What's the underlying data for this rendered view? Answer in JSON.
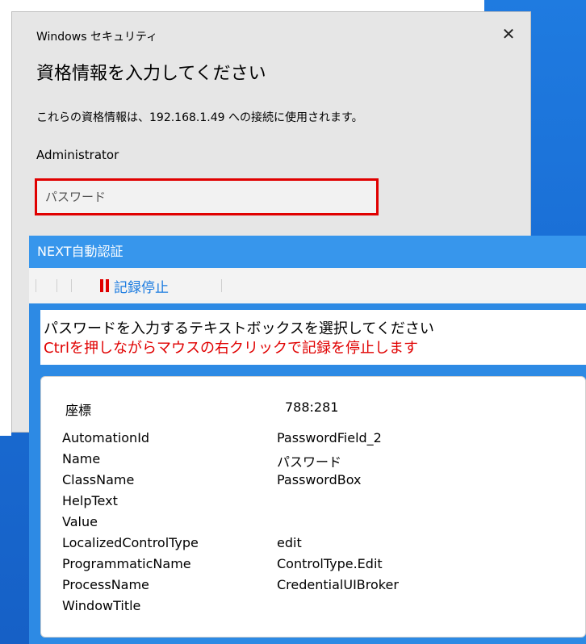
{
  "dialog": {
    "title": "Windows セキュリティ",
    "close_glyph": "✕",
    "heading": "資格情報を入力してください",
    "description": "これらの資格情報は、192.168.1.49 への接続に使用されます。",
    "username": "Administrator",
    "password_placeholder": "パスワード"
  },
  "next_window": {
    "title": "NEXT自動認証",
    "stop_label": "記録停止",
    "instruction_1": "パスワードを入力するテキストボックスを選択してください",
    "instruction_2": "Ctrlを押しながらマウスの右クリックで記録を停止します",
    "coord_label": "座標",
    "coord_value": "788:281",
    "properties": [
      {
        "key": "AutomationId",
        "value": "PasswordField_2"
      },
      {
        "key": "Name",
        "value": "パスワード"
      },
      {
        "key": "ClassName",
        "value": "PasswordBox"
      },
      {
        "key": "HelpText",
        "value": ""
      },
      {
        "key": "Value",
        "value": ""
      },
      {
        "key": "LocalizedControlType",
        "value": "edit"
      },
      {
        "key": "ProgrammaticName",
        "value": "ControlType.Edit"
      },
      {
        "key": "ProcessName",
        "value": "CredentialUIBroker"
      },
      {
        "key": "WindowTitle",
        "value": ""
      }
    ]
  },
  "colors": {
    "highlight_red": "#e00000",
    "accent_blue": "#1b7be0",
    "window_blue": "#2d8ae4"
  }
}
